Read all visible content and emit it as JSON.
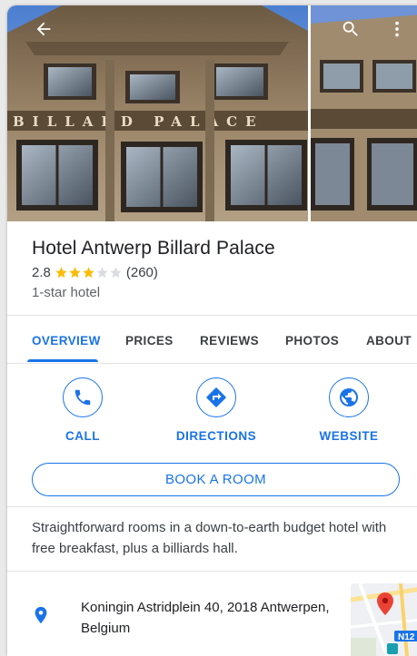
{
  "hotel": {
    "name": "Hotel Antwerp Billard Palace",
    "rating": "2.8",
    "stars": 2.8,
    "review_count": "(260)",
    "class": "1-star hotel",
    "description": "Straightforward rooms in a down-to-earth budget hotel with free breakfast, plus a billiards hall.",
    "address": "Koningin Astridplein 40, 2018 Antwerpen, Belgium",
    "facade_sign": "BILLARD PALACE"
  },
  "topbar": {
    "back_icon": "arrow-back-icon",
    "search_icon": "search-icon",
    "menu_icon": "more-vert-icon"
  },
  "tabs": [
    {
      "label": "OVERVIEW",
      "active": true
    },
    {
      "label": "PRICES",
      "active": false
    },
    {
      "label": "REVIEWS",
      "active": false
    },
    {
      "label": "PHOTOS",
      "active": false
    },
    {
      "label": "ABOUT",
      "active": false
    }
  ],
  "actions": [
    {
      "label": "CALL",
      "icon": "phone-icon"
    },
    {
      "label": "DIRECTIONS",
      "icon": "directions-icon"
    },
    {
      "label": "WEBSITE",
      "icon": "globe-icon"
    }
  ],
  "book_button": {
    "label": "BOOK A ROOM"
  },
  "map": {
    "road_label": "N12"
  },
  "colors": {
    "accent": "#1a73e8",
    "star": "#fbbc04",
    "star_empty": "#dadce0",
    "pin": "#1a73e8",
    "map_marker": "#ea4335"
  }
}
